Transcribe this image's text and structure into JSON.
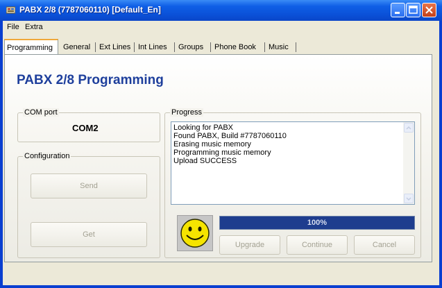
{
  "window": {
    "title": "PABX 2/8 (7787060110) [Default_En]"
  },
  "menu": {
    "items": [
      "File",
      "Extra"
    ]
  },
  "tabs": [
    {
      "label": "Programming",
      "active": true
    },
    {
      "label": "General"
    },
    {
      "label": "Ext Lines"
    },
    {
      "label": "Int Lines"
    },
    {
      "label": "Groups"
    },
    {
      "label": "Phone Book"
    },
    {
      "label": "Music"
    }
  ],
  "page": {
    "heading": "PABX 2/8 Programming"
  },
  "com_port": {
    "label": "COM port",
    "value": "COM2"
  },
  "configuration": {
    "label": "Configuration",
    "send_label": "Send",
    "get_label": "Get"
  },
  "progress": {
    "label": "Progress",
    "log": [
      "Looking for PABX",
      "Found PABX, Build #7787060110",
      "Erasing music memory",
      "Programming music memory",
      "Upload SUCCESS"
    ],
    "percent_text": "100%",
    "fraction": 1.0
  },
  "actions": {
    "upgrade_label": "Upgrade",
    "continue_label": "Continue",
    "cancel_label": "Cancel"
  },
  "colors": {
    "titlebar": "#0a4fd6",
    "heading": "#1e3f9c",
    "progress_fill": "#1e3d8e",
    "smiley": "#f5e400"
  },
  "icons": {
    "status": "smiley-face-icon"
  }
}
